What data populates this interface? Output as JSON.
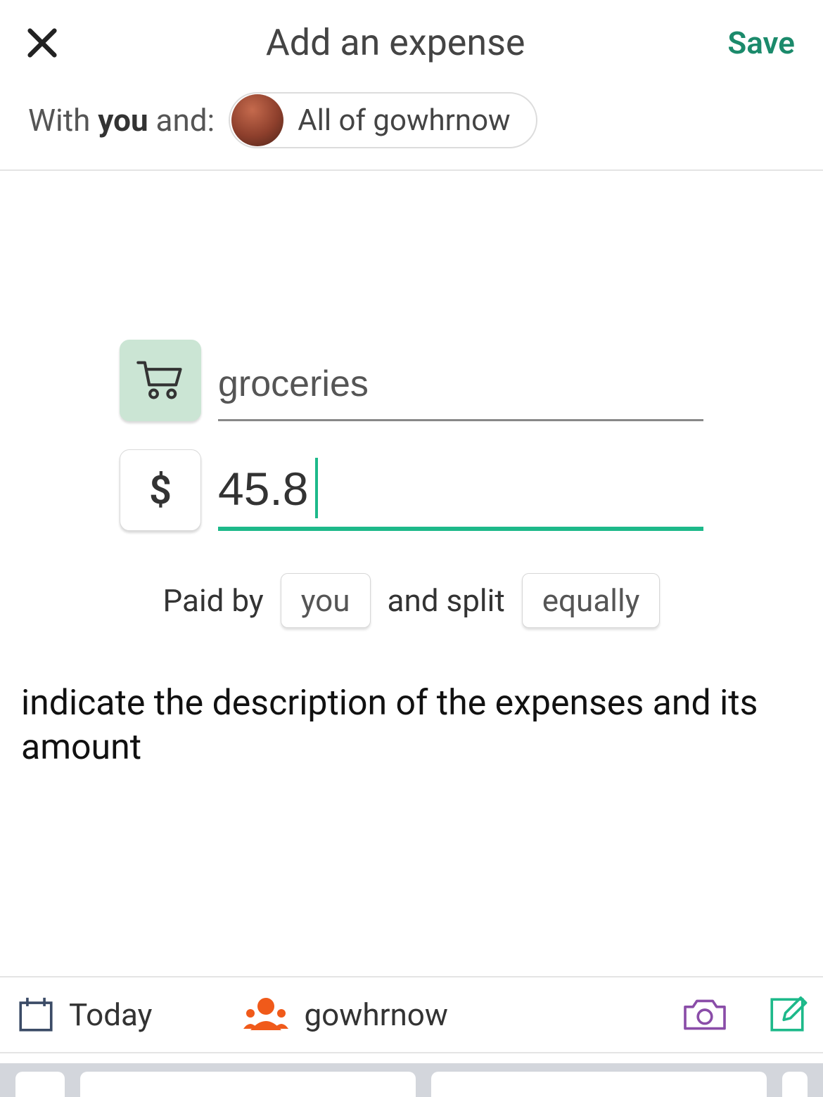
{
  "header": {
    "title": "Add an expense",
    "save_label": "Save"
  },
  "with": {
    "prefix": "With ",
    "you": "you",
    "and": " and:",
    "chip_label": "All of gowhrnow"
  },
  "expense": {
    "description": "groceries",
    "currency_symbol": "$",
    "amount": "45.8"
  },
  "split": {
    "paid_by_label": "Paid by",
    "payer": "you",
    "and_split_label": "and split",
    "method": "equally"
  },
  "instruction": "indicate the description of the expenses and its amount",
  "bottom": {
    "date_label": "Today",
    "group_label": "gowhrnow"
  }
}
